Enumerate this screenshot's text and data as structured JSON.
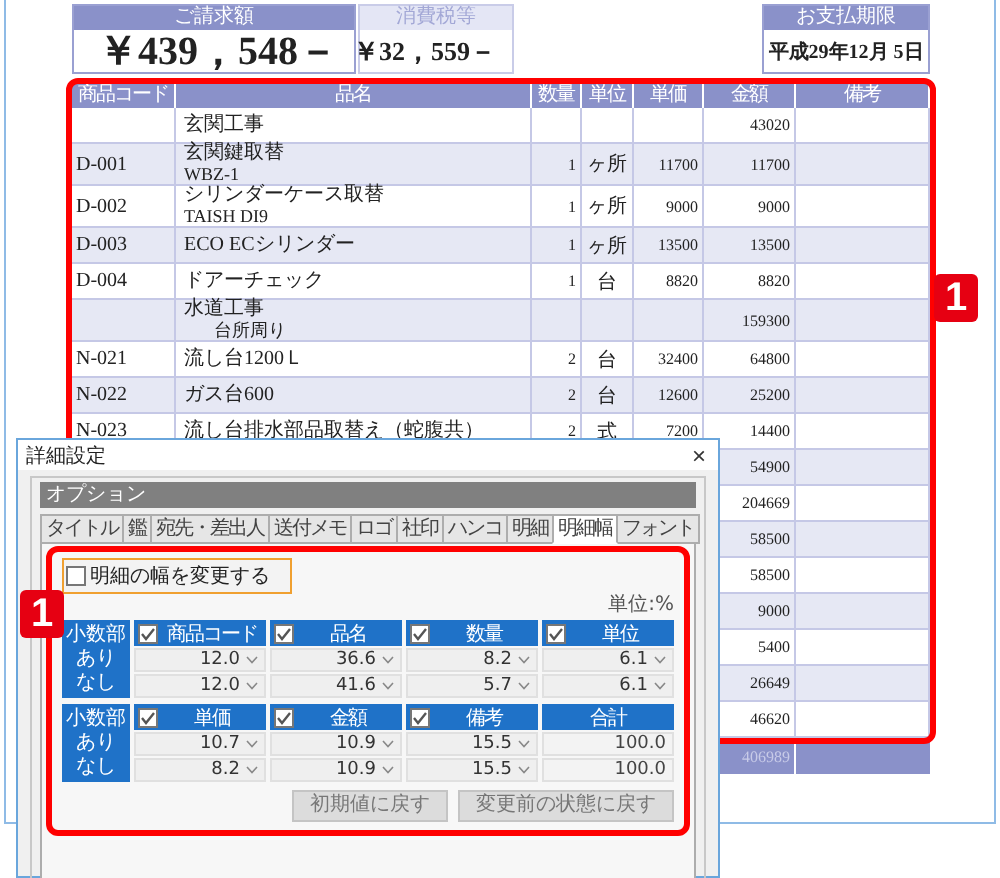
{
  "summary": [
    {
      "kind": "primary",
      "label": "ご請求額",
      "value": "￥439，548－"
    },
    {
      "kind": "secondary",
      "label": "消費税等",
      "value": "￥32，559－"
    },
    {
      "kind": "due",
      "label": "お支払期限",
      "value": "平成29年12月 5日"
    }
  ],
  "table": {
    "callout": "1",
    "columns": [
      "商品コード",
      "品名",
      "数量",
      "単位",
      "単価",
      "金額",
      "備考"
    ],
    "rows": [
      {
        "code": "",
        "name": "玄関工事",
        "amount": "43020"
      },
      {
        "code": "D-001",
        "name": "玄関鍵取替",
        "sub": "WBZ-1",
        "sub_indent": false,
        "qty": "1",
        "unit": "ヶ所",
        "price": "11700",
        "amount": "11700"
      },
      {
        "code": "D-002",
        "name": "シリンダーケース取替",
        "sub": "TAISH DI9",
        "sub_indent": false,
        "qty": "1",
        "unit": "ヶ所",
        "price": "9000",
        "amount": "9000"
      },
      {
        "code": "D-003",
        "name": "ECO ECシリンダー",
        "qty": "1",
        "unit": "ヶ所",
        "price": "13500",
        "amount": "13500"
      },
      {
        "code": "D-004",
        "name": "ドアーチェック",
        "qty": "1",
        "unit": "台",
        "price": "8820",
        "amount": "8820"
      },
      {
        "code": "",
        "name": "水道工事",
        "sub": "台所周り",
        "sub_indent": true,
        "amount": "159300"
      },
      {
        "code": "N-021",
        "name": "流し台1200Ｌ",
        "qty": "2",
        "unit": "台",
        "price": "32400",
        "amount": "64800"
      },
      {
        "code": "N-022",
        "name": "ガス台600",
        "qty": "2",
        "unit": "台",
        "price": "12600",
        "amount": "25200"
      },
      {
        "code": "N-023",
        "name": "流し台排水部品取替え（蛇腹共）",
        "qty": "2",
        "unit": "式",
        "price": "7200",
        "amount": "14400"
      },
      {
        "amount": "54900"
      },
      {
        "amount": "204669"
      },
      {
        "amount": "58500"
      },
      {
        "amount": "58500"
      },
      {
        "amount": "9000"
      },
      {
        "amount": "5400"
      },
      {
        "amount": "26649"
      },
      {
        "amount": "46620"
      }
    ],
    "total": {
      "amount": "406989"
    }
  },
  "dialog": {
    "title": "詳細設定",
    "close": "×",
    "group_title": "オプション",
    "callout": "1",
    "tabs": [
      {
        "label": "タイトル",
        "selected": false
      },
      {
        "label": "鑑",
        "selected": false
      },
      {
        "label": "宛先・差出人",
        "selected": false
      },
      {
        "label": "送付メモ",
        "selected": false
      },
      {
        "label": "ロゴ",
        "selected": false
      },
      {
        "label": "社印",
        "selected": false
      },
      {
        "label": "ハンコ",
        "selected": false
      },
      {
        "label": "明細",
        "selected": false
      },
      {
        "label": "明細幅",
        "selected": true
      },
      {
        "label": "フォント",
        "selected": false
      }
    ],
    "resize_checkbox": {
      "label": "明細の幅を変更する",
      "checked": false
    },
    "unit_note": "単位:%",
    "grids": [
      {
        "row_labels": [
          "小数部",
          "あり",
          "なし"
        ],
        "columns": [
          {
            "kind": "toggle",
            "label": "商品コード",
            "checked": true,
            "with_decimals": "12.0",
            "without_decimals": "12.0"
          },
          {
            "kind": "toggle",
            "label": "品名",
            "checked": true,
            "with_decimals": "36.6",
            "without_decimals": "41.6"
          },
          {
            "kind": "toggle",
            "label": "数量",
            "checked": true,
            "with_decimals": "8.2",
            "without_decimals": "5.7"
          },
          {
            "kind": "toggle",
            "label": "単位",
            "checked": true,
            "with_decimals": "6.1",
            "without_decimals": "6.1"
          }
        ]
      },
      {
        "row_labels": [
          "小数部",
          "あり",
          "なし"
        ],
        "columns": [
          {
            "kind": "toggle",
            "label": "単価",
            "checked": true,
            "with_decimals": "10.7",
            "without_decimals": "8.2"
          },
          {
            "kind": "toggle",
            "label": "金額",
            "checked": true,
            "with_decimals": "10.9",
            "without_decimals": "10.9"
          },
          {
            "kind": "toggle",
            "label": "備考",
            "checked": true,
            "with_decimals": "15.5",
            "without_decimals": "15.5"
          },
          {
            "kind": "sum",
            "label": "合計",
            "with_decimals": "100.0",
            "without_decimals": "100.0"
          }
        ]
      }
    ],
    "buttons": [
      "初期値に戻す",
      "変更前の状態に戻す"
    ]
  }
}
